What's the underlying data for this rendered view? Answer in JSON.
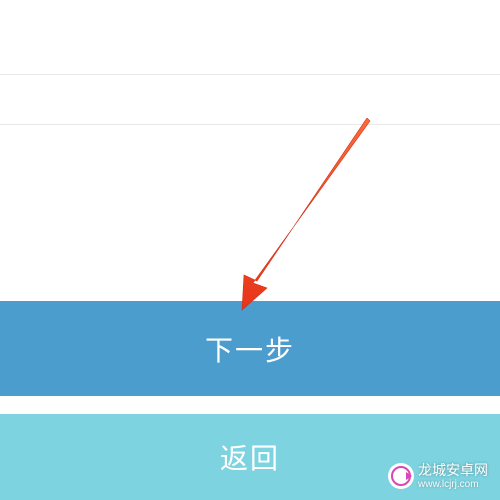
{
  "buttons": {
    "next_label": "下一步",
    "back_label": "返回"
  },
  "watermark": {
    "name": "龙城安卓网",
    "url": "www.lcjrj.com"
  },
  "colors": {
    "primary": "#4b9dce",
    "secondary": "#7dd4e0",
    "arrow": "#ee4b1f"
  }
}
